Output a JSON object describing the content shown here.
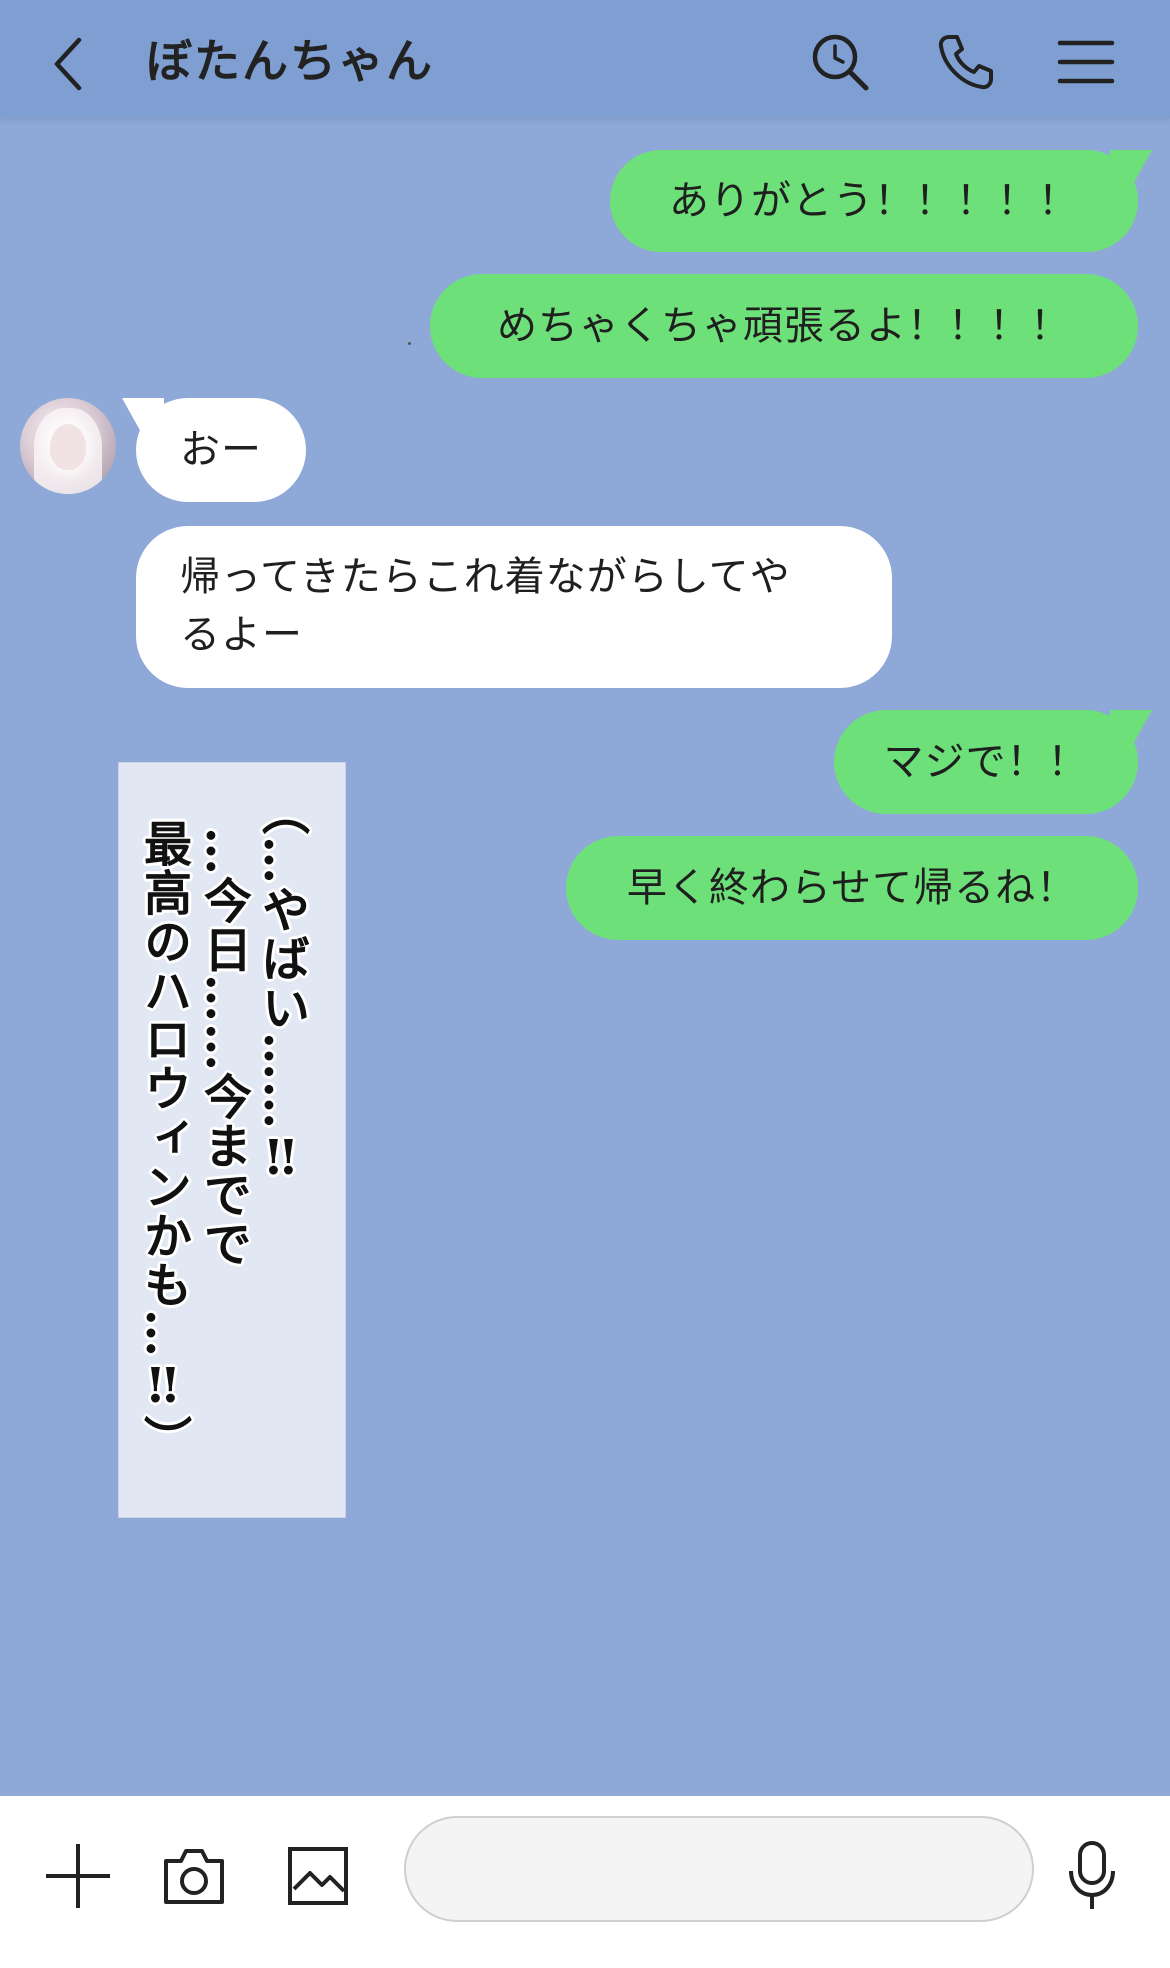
{
  "header": {
    "title": "ぼたんちゃん",
    "icons": [
      "back-icon",
      "search-icon",
      "phone-icon",
      "menu-icon"
    ]
  },
  "messages": [
    {
      "side": "sent",
      "text": "ありがとう！！！！！"
    },
    {
      "side": "sent",
      "text": "めちゃくちゃ頑張るよ！！！！"
    },
    {
      "side": "received",
      "text": "おー"
    },
    {
      "side": "received",
      "lines": [
        "帰ってきたらこれ着ながらしてや",
        "るよー"
      ]
    },
    {
      "side": "sent",
      "text": "マジで！！"
    },
    {
      "side": "sent",
      "text": "早く終わらせて帰るね！"
    }
  ],
  "thought": {
    "columns": [
      "（…やばい……‼",
      "…今日……今までで",
      "最高のハロウィンかも…‼）"
    ]
  },
  "input_bar": {
    "icons": [
      "plus-icon",
      "camera-icon",
      "image-icon",
      "microphone-icon"
    ],
    "message_value": ""
  },
  "colors": {
    "background": "#8ea9d8",
    "header": "#7f9fd3",
    "sent_bubble": "#6ee07a",
    "received_bubble": "#ffffff",
    "thought_box": "#e1e8f4"
  }
}
